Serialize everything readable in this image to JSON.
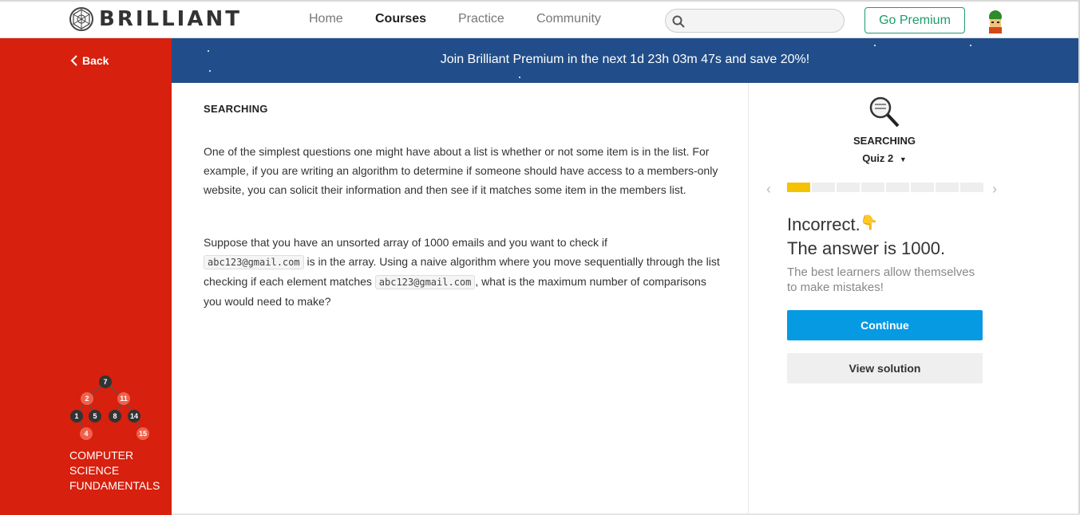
{
  "header": {
    "brand": "BRILLIANT",
    "nav": [
      "Home",
      "Courses",
      "Practice",
      "Community"
    ],
    "active_nav": "Courses",
    "search_placeholder": "",
    "premium_label": "Go Premium"
  },
  "sidebar": {
    "back_label": "Back",
    "course_title": "COMPUTER SCIENCE FUNDAMENTALS",
    "tree_nodes": [
      "7",
      "2",
      "11",
      "1",
      "5",
      "8",
      "14",
      "4",
      "15"
    ]
  },
  "banner": {
    "text": "Join Brilliant Premium in the next 1d 23h 03m 47s and save 20%!"
  },
  "problem": {
    "section_title": "SEARCHING",
    "para1": "One of the simplest questions one might have about a list is whether or not some item is in the list. For example, if you are writing an algorithm to determine if someone should have access to a members-only website, you can solicit their information and then see if it matches some item in the members list.",
    "para2_a": "Suppose that you have an unsorted array of 1000 emails and you want to check if",
    "para2_code1": "abc123@gmail.com",
    "para2_b": "is in the array. Using a naive algorithm where you move sequentially through the list checking if each element matches",
    "para2_code2": "abc123@gmail.com",
    "para2_c": ", what is the maximum number of comparisons you would need to make?"
  },
  "quiz": {
    "title": "SEARCHING",
    "subtitle": "Quiz 2",
    "progress_total": 8,
    "progress_done": 1,
    "result": "Incorrect.",
    "result_emoji": "👇",
    "answer": "The answer is 1000.",
    "encourage": "The best learners allow themselves to make mistakes!",
    "continue_label": "Continue",
    "view_solution_label": "View solution"
  },
  "colors": {
    "sidebar": "#d7200e",
    "banner": "#214e8a",
    "accent_green": "#1d9d6b",
    "continue_blue": "#069ae3",
    "progress_done": "#f5c200"
  }
}
